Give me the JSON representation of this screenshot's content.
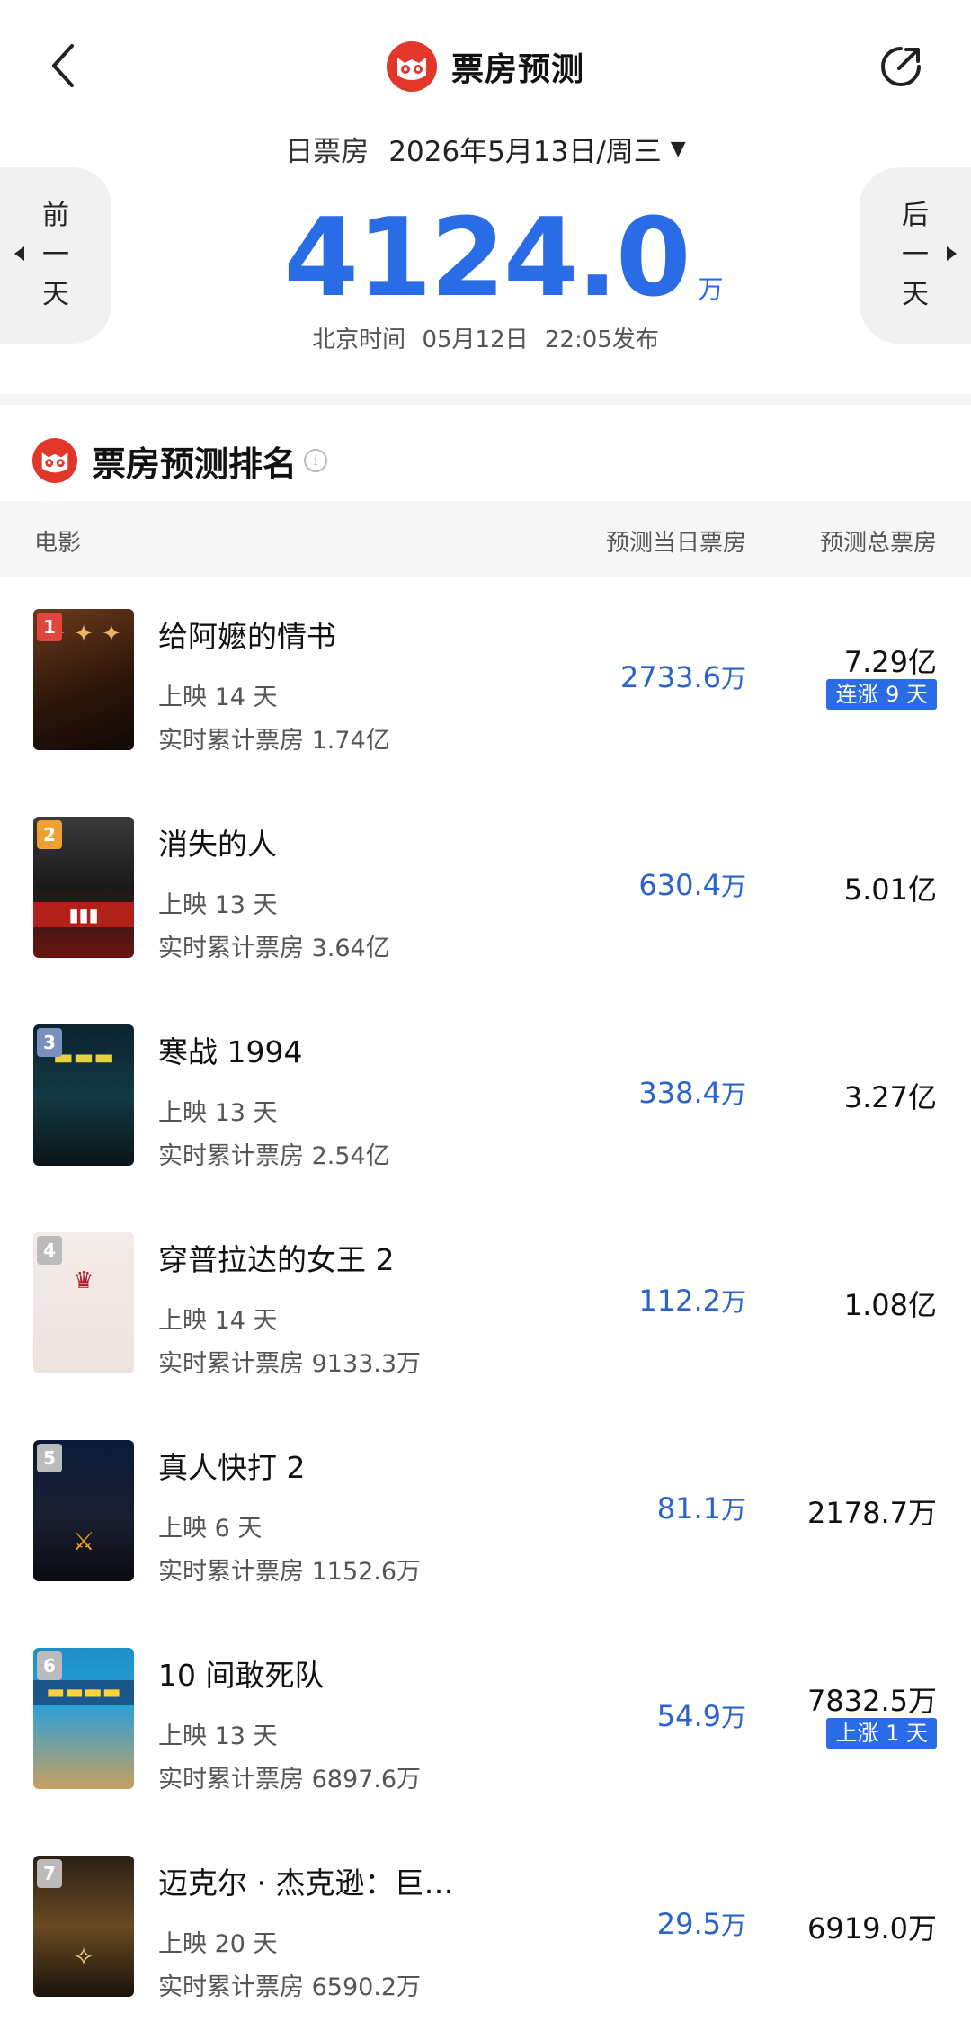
{
  "header": {
    "title": "票房预测",
    "back_icon": "back-arrow-icon",
    "share_icon": "share-icon"
  },
  "date_bar": {
    "type_label": "日票房",
    "date": "2026年5月13日/周三",
    "caret": "▼"
  },
  "nav": {
    "prev_label": "前一天",
    "next_label": "后一天"
  },
  "summary": {
    "total": "4124.0",
    "unit": "万",
    "publish_prefix": "北京时间",
    "publish_date": "05月12日",
    "publish_time": "22:05发布"
  },
  "section": {
    "title": "票房预测排名",
    "info_icon": "info-icon"
  },
  "table": {
    "col_movie": "电影",
    "col_daily": "预测当日票房",
    "col_total": "预测总票房"
  },
  "colors": {
    "accent_blue": "#2a6be6",
    "brand_red": "#e3362a"
  },
  "movies": [
    {
      "rank": "1",
      "name": "给阿嬷的情书",
      "days": "上映 14 天",
      "cumulative": "实时累计票房 1.74亿",
      "daily": "2733.6",
      "daily_unit": "万",
      "total": "7.29亿",
      "badge": "连涨 9 天",
      "rank_color": "#e0463c"
    },
    {
      "rank": "2",
      "name": "消失的人",
      "days": "上映 13 天",
      "cumulative": "实时累计票房 3.64亿",
      "daily": "630.4",
      "daily_unit": "万",
      "total": "5.01亿",
      "badge": "",
      "rank_color": "#f0a030"
    },
    {
      "rank": "3",
      "name": "寒战 1994",
      "days": "上映 13 天",
      "cumulative": "实时累计票房 2.54亿",
      "daily": "338.4",
      "daily_unit": "万",
      "total": "3.27亿",
      "badge": "",
      "rank_color": "#7a90c0"
    },
    {
      "rank": "4",
      "name": "穿普拉达的女王 2",
      "days": "上映 14 天",
      "cumulative": "实时累计票房 9133.3万",
      "daily": "112.2",
      "daily_unit": "万",
      "total": "1.08亿",
      "badge": "",
      "rank_color": "#bbbbbb"
    },
    {
      "rank": "5",
      "name": "真人快打 2",
      "days": "上映 6 天",
      "cumulative": "实时累计票房 1152.6万",
      "daily": "81.1",
      "daily_unit": "万",
      "total": "2178.7万",
      "badge": "",
      "rank_color": "#bbbbbb"
    },
    {
      "rank": "6",
      "name": "10 间敢死队",
      "days": "上映 13 天",
      "cumulative": "实时累计票房 6897.6万",
      "daily": "54.9",
      "daily_unit": "万",
      "total": "7832.5万",
      "badge": "上涨 1 天",
      "rank_color": "#bbbbbb"
    },
    {
      "rank": "7",
      "name": "迈克尔 · 杰克逊：巨…",
      "days": "上映 20 天",
      "cumulative": "实时累计票房 6590.2万",
      "daily": "29.5",
      "daily_unit": "万",
      "total": "6919.0万",
      "badge": "",
      "rank_color": "#bbbbbb"
    }
  ]
}
